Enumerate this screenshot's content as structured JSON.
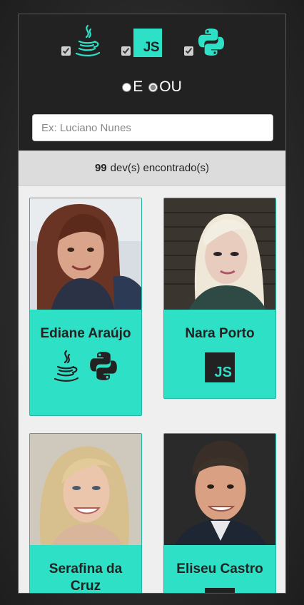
{
  "filters": {
    "techs": [
      {
        "id": "java",
        "icon": "java-icon",
        "checked": true
      },
      {
        "id": "javascript",
        "icon": "javascript-icon",
        "label": "JS",
        "checked": true
      },
      {
        "id": "python",
        "icon": "python-icon",
        "checked": true
      }
    ],
    "logic": {
      "and_label": "E",
      "or_label": "OU",
      "selected": "OU"
    },
    "search": {
      "placeholder": "Ex: Luciano Nunes",
      "value": ""
    }
  },
  "results": {
    "count": "99",
    "suffix": "dev(s) encontrado(s)"
  },
  "devs": [
    {
      "name": "Ediane Araújo",
      "techs": [
        "java",
        "python"
      ]
    },
    {
      "name": "Nara Porto",
      "techs": [
        "javascript"
      ],
      "js_label": "JS"
    },
    {
      "name": "Serafina da Cruz",
      "techs": []
    },
    {
      "name": "Eliseu Castro",
      "techs": [
        "javascript"
      ]
    }
  ],
  "colors": {
    "accent": "#2ee0c6",
    "header_bg": "#222222",
    "count_bg": "#dcdcdc",
    "page_bg": "#efefef"
  }
}
